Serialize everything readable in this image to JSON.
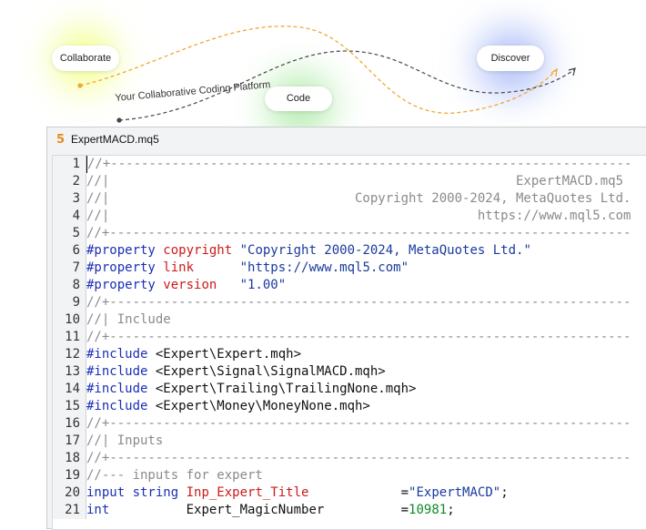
{
  "banner": {
    "collaborate_label": "Collaborate",
    "code_label": "Code",
    "discover_label": "Discover",
    "tagline": "Your Collaborative Coding Platform",
    "tagline_accent": "Your Collaborative Coding Platform"
  },
  "editor": {
    "file_icon": "5",
    "file_name": "ExpertMACD.mq5",
    "lines": [
      {
        "n": "1",
        "parts": [
          {
            "t": "//+--------------------------------------------------------------------",
            "c": "c-comment"
          }
        ]
      },
      {
        "n": "2",
        "parts": [
          {
            "t": "//|                                                     ExpertMACD.mq5",
            "c": "c-comment"
          }
        ]
      },
      {
        "n": "3",
        "parts": [
          {
            "t": "//|                                Copyright 2000-2024, MetaQuotes Ltd.",
            "c": "c-comment"
          }
        ]
      },
      {
        "n": "4",
        "parts": [
          {
            "t": "//|                                                https://www.mql5.com",
            "c": "c-comment"
          }
        ]
      },
      {
        "n": "5",
        "parts": [
          {
            "t": "//+--------------------------------------------------------------------",
            "c": "c-comment"
          }
        ]
      },
      {
        "n": "6",
        "parts": [
          {
            "t": "#property ",
            "c": "c-pre"
          },
          {
            "t": "copyright ",
            "c": "c-key"
          },
          {
            "t": "\"Copyright 2000-2024, MetaQuotes Ltd.\"",
            "c": "c-str"
          }
        ]
      },
      {
        "n": "7",
        "parts": [
          {
            "t": "#property ",
            "c": "c-pre"
          },
          {
            "t": "link      ",
            "c": "c-key"
          },
          {
            "t": "\"https://www.mql5.com\"",
            "c": "c-str"
          }
        ]
      },
      {
        "n": "8",
        "parts": [
          {
            "t": "#property ",
            "c": "c-pre"
          },
          {
            "t": "version   ",
            "c": "c-key"
          },
          {
            "t": "\"1.00\"",
            "c": "c-str"
          }
        ]
      },
      {
        "n": "9",
        "parts": [
          {
            "t": "//+--------------------------------------------------------------------",
            "c": "c-comment"
          }
        ]
      },
      {
        "n": "10",
        "parts": [
          {
            "t": "//| Include",
            "c": "c-comment"
          }
        ]
      },
      {
        "n": "11",
        "parts": [
          {
            "t": "//+--------------------------------------------------------------------",
            "c": "c-comment"
          }
        ]
      },
      {
        "n": "12",
        "parts": [
          {
            "t": "#include ",
            "c": "c-pre"
          },
          {
            "t": "<Expert\\Expert.mqh>",
            "c": "c-plain"
          }
        ]
      },
      {
        "n": "13",
        "parts": [
          {
            "t": "#include ",
            "c": "c-pre"
          },
          {
            "t": "<Expert\\Signal\\SignalMACD.mqh>",
            "c": "c-plain"
          }
        ]
      },
      {
        "n": "14",
        "parts": [
          {
            "t": "#include ",
            "c": "c-pre"
          },
          {
            "t": "<Expert\\Trailing\\TrailingNone.mqh>",
            "c": "c-plain"
          }
        ]
      },
      {
        "n": "15",
        "parts": [
          {
            "t": "#include ",
            "c": "c-pre"
          },
          {
            "t": "<Expert\\Money\\MoneyNone.mqh>",
            "c": "c-plain"
          }
        ]
      },
      {
        "n": "16",
        "parts": [
          {
            "t": "//+--------------------------------------------------------------------",
            "c": "c-comment"
          }
        ]
      },
      {
        "n": "17",
        "parts": [
          {
            "t": "//| Inputs",
            "c": "c-comment"
          }
        ]
      },
      {
        "n": "18",
        "parts": [
          {
            "t": "//+--------------------------------------------------------------------",
            "c": "c-comment"
          }
        ]
      },
      {
        "n": "19",
        "parts": [
          {
            "t": "//--- inputs for expert",
            "c": "c-comment"
          }
        ]
      },
      {
        "n": "20",
        "parts": [
          {
            "t": "input ",
            "c": "c-type"
          },
          {
            "t": "string ",
            "c": "c-type"
          },
          {
            "t": "Inp_Expert_Title            ",
            "c": "c-var"
          },
          {
            "t": "=",
            "c": "c-plain"
          },
          {
            "t": "\"ExpertMACD\"",
            "c": "c-str"
          },
          {
            "t": ";",
            "c": "c-plain"
          }
        ]
      },
      {
        "n": "21",
        "parts": [
          {
            "t": "int    ",
            "c": "c-type"
          },
          {
            "t": "      Expert_MagicNumber          ",
            "c": "c-plain"
          },
          {
            "t": "=",
            "c": "c-plain"
          },
          {
            "t": "10981",
            "c": "c-num"
          },
          {
            "t": ";",
            "c": "c-plain"
          }
        ]
      }
    ]
  }
}
